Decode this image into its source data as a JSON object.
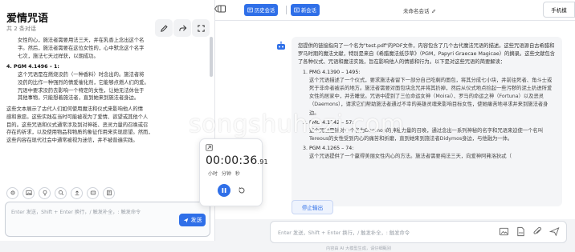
{
  "colors": {
    "accent": "#2f6fe8",
    "panel_bg": "#ffffff",
    "page_bg": "#f3f4f6",
    "bubble_bg": "#f4f5f7"
  },
  "left": {
    "title": "爱情咒语",
    "subtitle": "共 2 条对话",
    "header_icons": [
      "edit-icon",
      "share-icon",
      "expand-icon"
    ],
    "content": {
      "top_lines": [
        "女性的心，施法者需要用法三天，并在乳香上念出这个名",
        "字。然后，施法者需要在这位女性的，心中默念这个名字",
        "七次，施法七天过样获，以期成功。"
      ],
      "item_title": "4. PGM 4.1496 – 1:",
      "item_lines": [
        "这个咒语是在燃烧没药（一种香料）时念出的。施法者将",
        "没药的比作一种强烈的情爱催化剂，它能够点燃人们的爱。",
        "咒语中要求没药去影响一个特定的女性，让她无法休住于",
        "其他事物，只能想着施法者，直到她来到施法者身边。"
      ],
      "closing_lines": [
        "这些文本展示了古代人们如何使用魔法和仪式来影响他人的情",
        "感和意愿。这些实践在当时可能被视为了爱情、欲望或其他个人",
        "目的。这些咒语和仪式通常涉及到对神祇、恶灵力量的召唤或召",
        "存在的祈求，以及使用物品和物质的象征作用来实现愿望。然而，",
        "这些内容在现代社会中通常被视为迷信，并不被普遍实践。"
      ]
    },
    "tool_icons": [
      "settings-icon",
      "image-icon",
      "bulb-icon",
      "search-icon",
      "upload-icon",
      "mask-icon",
      "template-icon"
    ],
    "input_placeholder": "Enter 发送，Shift + Enter 换行，/ 触发补全，: 触发命令",
    "send_label": "发送"
  },
  "right": {
    "history_label": "历史会话",
    "new_chat_label": "新会话",
    "chat_title": "未命名会话",
    "model_label": "手机模",
    "message": {
      "intro": "您提供的链接指向了一个名为\"test.pdf\"的PDF文件，内容包含了几个古代魔法咒语的描述。这些咒语源自古希腊和罗马时期的魔法文献，特别是来自《希腊魔法纸莎草》（PGM，Papyri Graecae Magicae）的摘录。这些文献包含了各种仪式、咒语和魔法实践，旨在影响他人的情感和行为。以下是对这些咒语的简要解读：",
      "items": [
        {
          "title": "PMG 4.1390 – 1495:",
          "text": "这个咒语描述了一个仪式，要求施法者留下一部分自己吃剩的面包，将其分成七小块，并前往死者、角斗士或死于非命者被杀的地方。施法者需要对面包块念咒并将其扔掉，然后从仪式地点捡起一些污秽的泥土扔进所爱女性的居家中，并去睡觉。咒语中提到了三位命运女神（Moirai）、罗马的命运之神（Fortuna）以及恶灵（Daemons），请求它们帮助施法者通过不幸的英雄灵魂来影响目标女性，使她痛苦地寻求并来到施法者身边。"
        },
        {
          "title": "PMG 4.1342 – 57:",
          "text": "这个咒语是针对一个名为Daemon的神秘力量的召唤，通过念出一系列神秘的名字和咒语来迫使一个名叫Tereous的女性受到内心的痛苦和折磨，直到她来到施法者Didymos身边，与他融为一体。"
        },
        {
          "title": "PGM 4.1265 – 74:",
          "text": "这个咒语提供了一个赢得美丽女性内心的方法。施法者需要纯法三天，向爱神阿弗洛狄忒（"
        }
      ]
    },
    "stop_label": "停止输出",
    "input_placeholder": "Enter 发送，Shift + Enter 换行，/ 触发补全，: 触发命令",
    "input_icons": [
      "image-icon",
      "pdf-icon",
      "attachment-icon",
      "send-icon"
    ],
    "footnote": "内容由 AI 大模型生成，请仔细甄别"
  },
  "timer": {
    "time_main": "00:00:36",
    "time_cs": ".91",
    "units": "小时 分钟 秒"
  },
  "watermark": "songshuhezi.com"
}
